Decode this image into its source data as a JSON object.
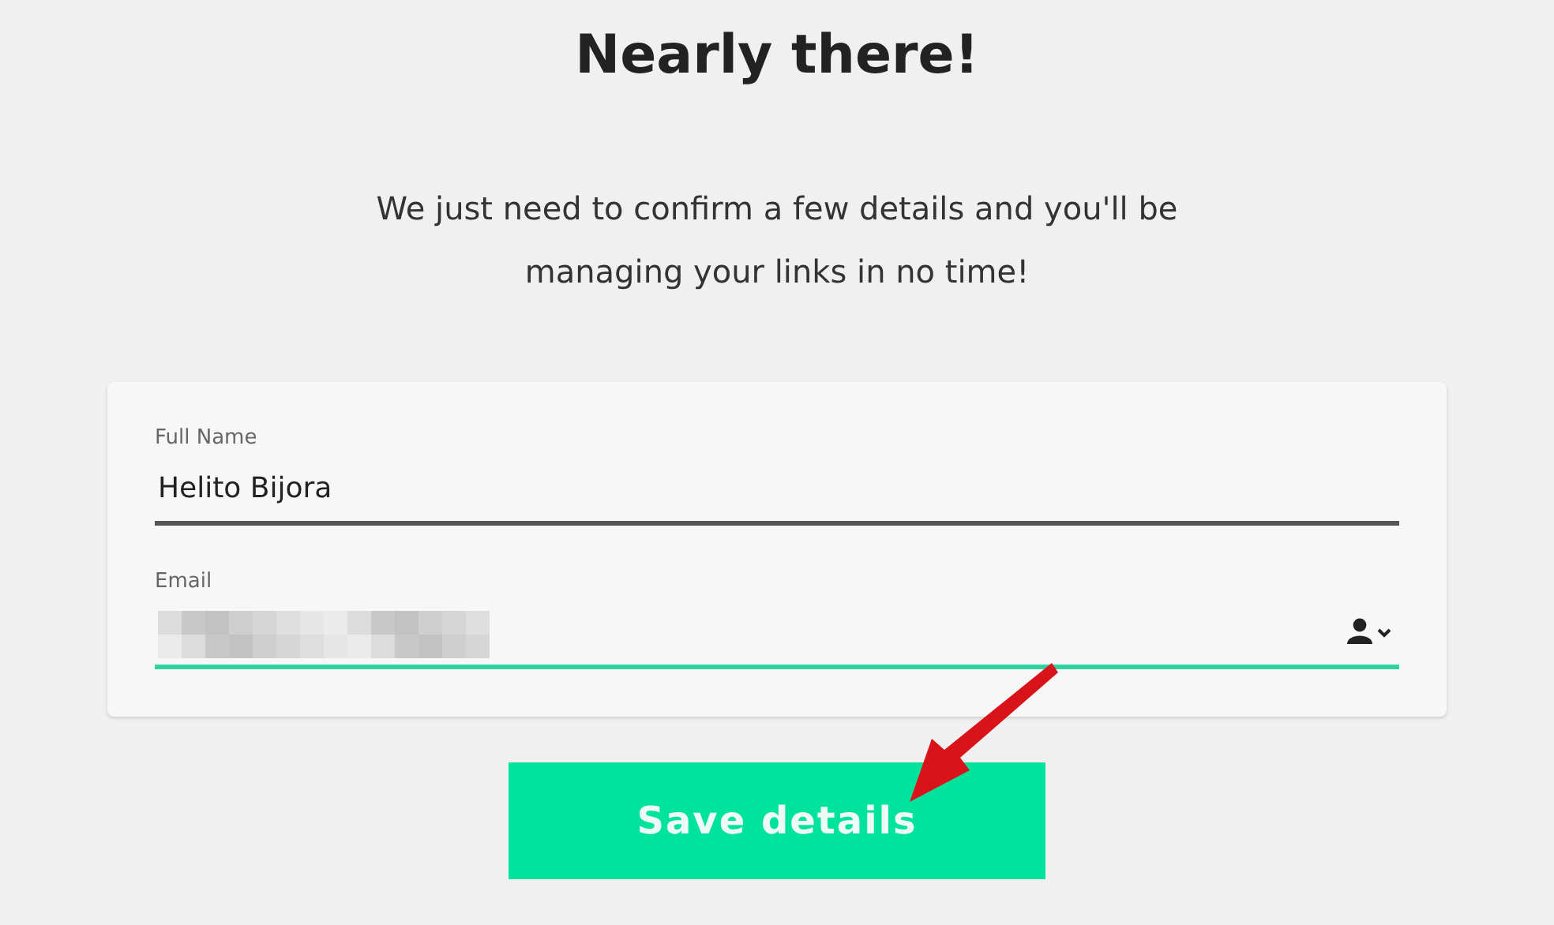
{
  "heading": "Nearly there!",
  "intro": "We just need to confirm a few details and you'll be managing your links in no time!",
  "fields": [
    {
      "label": "Full Name",
      "value": "Helito Bijora",
      "focused": false,
      "redacted": false,
      "contact_icon": false
    },
    {
      "label": "Email",
      "focused": true,
      "redacted": true,
      "contact_icon": true
    }
  ],
  "button": "Save details"
}
